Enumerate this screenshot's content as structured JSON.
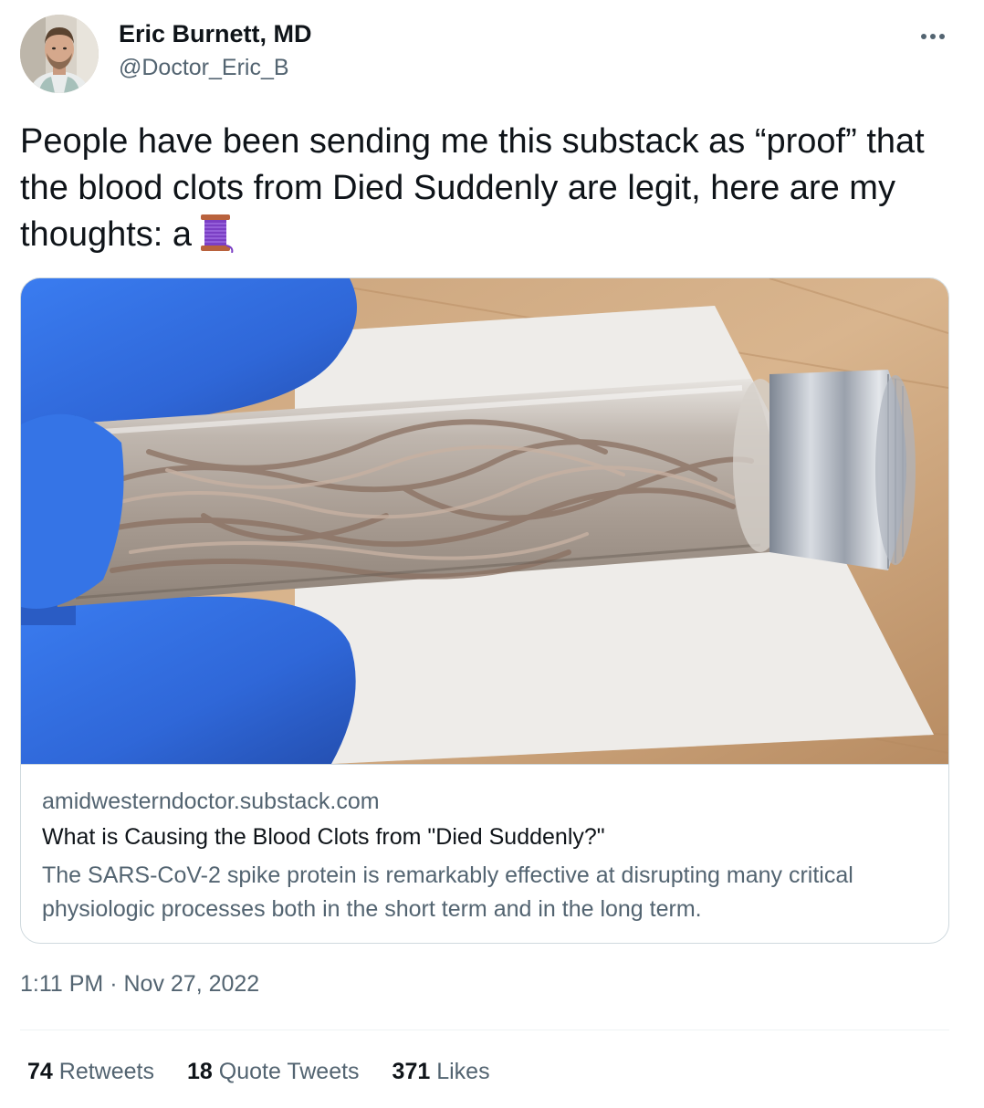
{
  "author": {
    "name": "Eric Burnett, MD",
    "handle": "@Doctor_Eric_B",
    "avatar_icon": "profile-photo"
  },
  "more_icon": "more-horizontal-icon",
  "tweet": {
    "text": "People have been sending me this substack as “proof” that the blood clots from Died Suddenly are legit, here are my thoughts: a",
    "emoji_icon": "thread-spool-icon"
  },
  "card": {
    "domain": "amidwesterndoctor.substack.com",
    "title": "What is Causing the Blood Clots from \"Died Suddenly?\"",
    "description": "The SARS-CoV-2 spike protein is remarkably effective at disrupting many critical physiologic processes both in the short term and in the long term."
  },
  "timestamp": {
    "time": "1:11 PM",
    "separator": "·",
    "date": "Nov 27, 2022"
  },
  "stats": {
    "retweets": {
      "count": "74",
      "label": "Retweets"
    },
    "quote_tweets": {
      "count": "18",
      "label": "Quote Tweets"
    },
    "likes": {
      "count": "371",
      "label": "Likes"
    }
  },
  "colors": {
    "text_primary": "#0f1419",
    "text_secondary": "#536471",
    "border": "#cfd9de",
    "glove_blue": "#2f6fe0"
  }
}
